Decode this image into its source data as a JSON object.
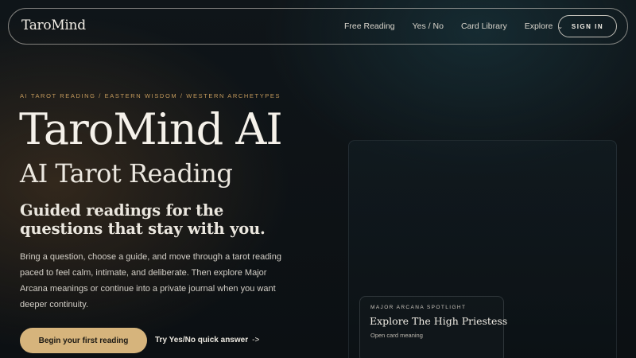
{
  "nav": {
    "logo": "TaroMind",
    "links": [
      "Free Reading",
      "Yes / No",
      "Card Library",
      "Explore"
    ],
    "explore_chevron": "⌄",
    "sign_in": "SIGN IN"
  },
  "hero": {
    "eyebrow": "AI TAROT READING / EASTERN WISDOM / WESTERN ARCHETYPES",
    "title": "TaroMind AI",
    "subtitle": "AI Tarot Reading",
    "tagline": "Guided readings for the questions that stay with you.",
    "body": "Bring a question, choose a guide, and move through a tarot reading paced to feel calm, intimate, and deliberate. Then explore Major Arcana meanings or continue into a private journal when you want deeper continuity.",
    "primary_cta": "Begin your first reading",
    "secondary_cta": "Try Yes/No quick answer",
    "secondary_arrow": "->"
  },
  "spotlight": {
    "eyebrow": "MAJOR ARCANA SPOTLIGHT",
    "title": "Explore The High Priestess",
    "link": "Open card meaning"
  },
  "colors": {
    "accent": "#d6b47c",
    "eyebrow": "#c49a5c",
    "background": "#0f1519"
  }
}
